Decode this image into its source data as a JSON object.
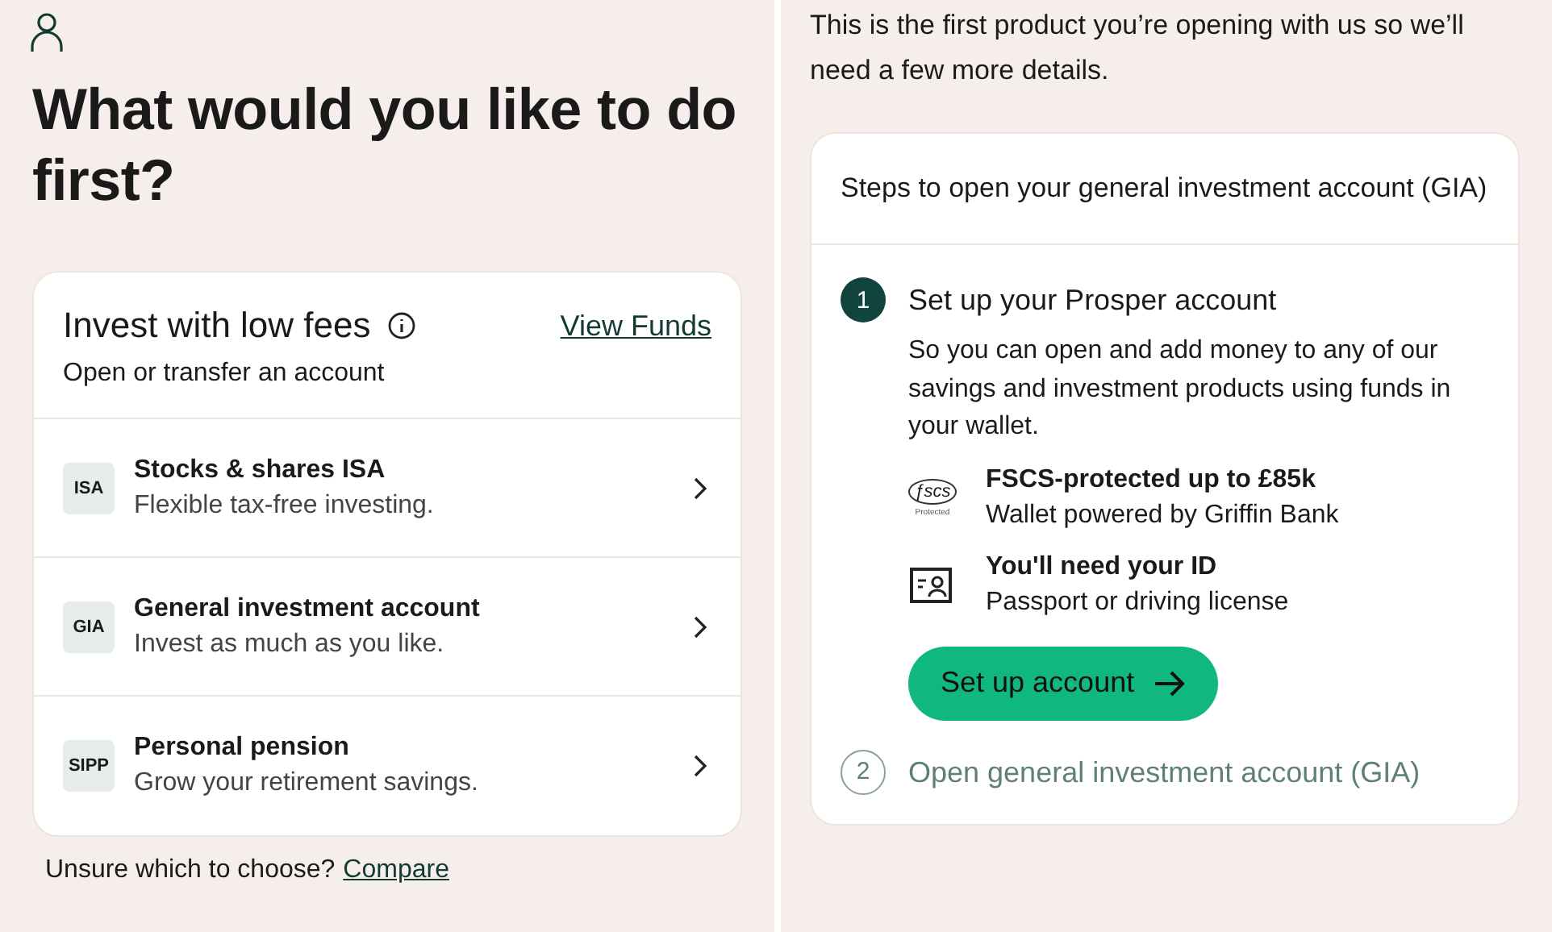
{
  "left": {
    "title": "What would you like to do first?",
    "card": {
      "title": "Invest with low fees",
      "link": "View Funds",
      "subtitle": "Open or transfer an account",
      "products": [
        {
          "badge": "ISA",
          "name": "Stocks & shares ISA",
          "description": "Flexible tax-free investing."
        },
        {
          "badge": "GIA",
          "name": "General investment account",
          "description": "Invest as much as you like."
        },
        {
          "badge": "SIPP",
          "name": "Personal pension",
          "description": "Grow your retirement savings."
        }
      ]
    },
    "footer": {
      "text": "Unsure which to choose?",
      "link": "Compare"
    }
  },
  "right": {
    "intro": "This is the first product you’re opening with us so we’ll need a few more details.",
    "card": {
      "title": "Steps to open your general investment account (GIA)",
      "steps": [
        {
          "number": "1",
          "title": "Set up your Prosper account",
          "active": true,
          "description": "So you can open and add money to any of our savings and investment products using funds in your wallet.",
          "features": [
            {
              "kind": "fscs",
              "logo_text": "ƒscs",
              "logo_caption": "Protected",
              "title": "FSCS-protected up to £85k",
              "text": "Wallet powered by Griffin Bank"
            },
            {
              "kind": "id",
              "title": "You'll need your ID",
              "text": "Passport or driving license"
            }
          ],
          "button": "Set up account"
        },
        {
          "number": "2",
          "title": "Open general investment account (GIA)",
          "active": false
        }
      ]
    }
  }
}
